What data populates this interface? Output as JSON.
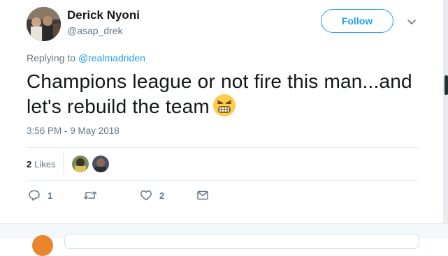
{
  "author": {
    "name": "Derick Nyoni",
    "handle": "@asap_drek"
  },
  "follow_label": "Follow",
  "reply": {
    "prefix": "Replying to ",
    "mention": "@realmadriden"
  },
  "tweet": {
    "text": "Champions league or not fire this man...and let's rebuild the team",
    "emoji": "persevering-face-emoji"
  },
  "timestamp": "3:56 PM - 9 May 2018",
  "likes": {
    "count": "2",
    "label": "Likes"
  },
  "actions": {
    "replies": "1",
    "retweets": "",
    "likes": "2"
  },
  "colors": {
    "accent": "#1da1f2",
    "muted": "#657786",
    "text": "#14171a",
    "divider": "#e6ecf0"
  },
  "icons": [
    "chevron-down-icon",
    "reply-icon",
    "retweet-icon",
    "heart-icon",
    "message-icon"
  ]
}
